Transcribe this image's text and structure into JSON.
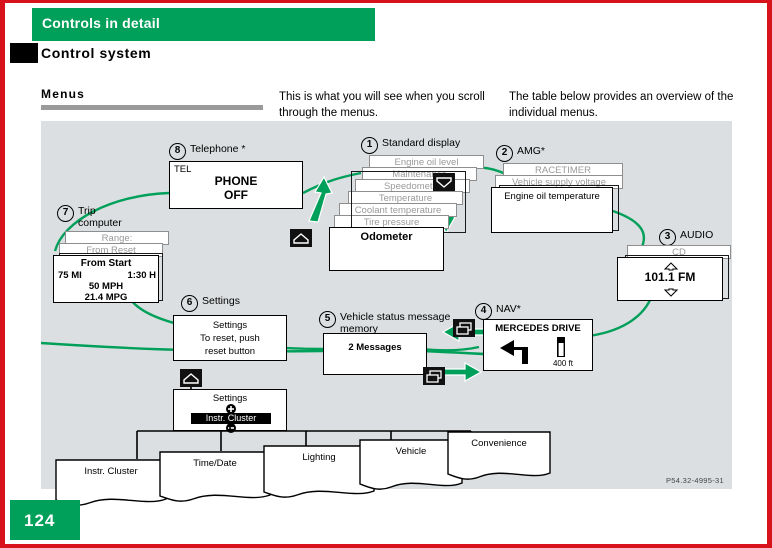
{
  "header": {
    "chapter_title": "Controls in detail",
    "section_title": "Control system",
    "topic_label": "Menus",
    "intro_left": "This is what you will see when you scroll through the menus.",
    "intro_right": "The table below provides an overview of the individual menus."
  },
  "colors": {
    "brand_green": "#00a05a",
    "border_red": "#d8121a",
    "canvas_bg": "#dcdfe1",
    "flow_line": "#00a05a"
  },
  "diagram": {
    "credit": "P54.32-4995-31",
    "nodes": [
      {
        "number": "1",
        "label": "Standard display",
        "screens": [
          "Engine oil level",
          "Maintenance",
          "Speedometer",
          "Temperature",
          "Coolant temperature",
          "Tire pressure"
        ],
        "active": "Odometer"
      },
      {
        "number": "2",
        "label": "AMG*",
        "screens": [
          "RACETIMER",
          "Vehicle supply voltage"
        ],
        "active": "Engine oil temperature"
      },
      {
        "number": "3",
        "label": "AUDIO",
        "screens": [
          "CD"
        ],
        "active": "101.1  FM"
      },
      {
        "number": "4",
        "label": "NAV*",
        "screens": [],
        "active": "MERCEDES DRIVE",
        "distance": "400 ft"
      },
      {
        "number": "5",
        "label": "Vehicle status message memory",
        "screens": [],
        "active": "2 Messages"
      },
      {
        "number": "6",
        "label": "Settings",
        "screens": [],
        "active_lines": [
          "Settings",
          "To reset, push",
          "reset button"
        ]
      },
      {
        "number": "7",
        "label": "Trip computer",
        "screens": [
          "Range:",
          "From Reset"
        ],
        "active_title": "From Start",
        "active_rows": [
          {
            "left": "75 MI",
            "right": "1:30 H"
          },
          {
            "center": "50 MPH"
          },
          {
            "center": "21.4 MPG"
          }
        ]
      },
      {
        "number": "8",
        "label": "Telephone *",
        "screens": [],
        "corner": "TEL",
        "active_lines": [
          "PHONE",
          "OFF"
        ]
      }
    ],
    "settings_detail": {
      "title": "Settings",
      "selected": "Instr. Cluster"
    },
    "submenu_tabs": [
      "Instr. Cluster",
      "Time/Date",
      "Lighting",
      "Vehicle",
      "Convenience"
    ],
    "icons": [
      {
        "name": "up-chevron-icon"
      },
      {
        "name": "down-chevron-icon"
      },
      {
        "name": "back-icon"
      }
    ]
  },
  "footer": {
    "page_number": "124"
  }
}
